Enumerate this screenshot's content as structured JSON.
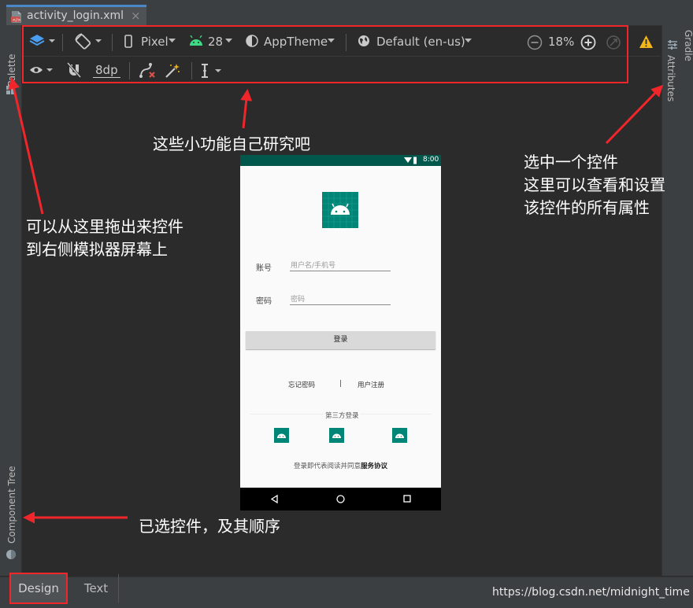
{
  "tab": {
    "filename": "activity_login.xml",
    "close": "×"
  },
  "left_panel": {
    "palette": "Palette",
    "component_tree": "Component Tree"
  },
  "right_panel": {
    "gradle": "Gradle",
    "attributes": "Attributes"
  },
  "toolbar": {
    "device": "Pixel",
    "api_level": "28",
    "theme": "AppTheme",
    "locale": "Default (en-us)",
    "zoom": "18%",
    "default_margin": "8dp"
  },
  "phone": {
    "clock": "8:00",
    "account_label": "账号",
    "account_placeholder": "用户名/手机号",
    "password_label": "密码",
    "password_placeholder": "密码",
    "login_button": "登录",
    "forgot_password": "忘记密码",
    "divider": "|",
    "register": "用户注册",
    "third_party": "第三方登录",
    "agreement_prefix": "登录即代表阅读并同意",
    "agreement_link": "服务协议"
  },
  "annotations": {
    "toolbar_note": "这些小功能自己研究吧",
    "palette_note_1": "可以从这里拖出来控件",
    "palette_note_2": "到右侧模拟器屏幕上",
    "attributes_note_1": "选中一个控件",
    "attributes_note_2": "这里可以查看和设置",
    "attributes_note_3": "该控件的所有属性",
    "tree_note": "已选控件，及其顺序"
  },
  "bottom_tabs": {
    "design": "Design",
    "text": "Text"
  },
  "watermark": "https://blog.csdn.net/midnight_time",
  "colors": {
    "highlight": "#f0262a",
    "app_primary": "#008577",
    "status_bar": "#00574b",
    "android_green": "#3ddc84",
    "warning": "#f2b51b"
  }
}
